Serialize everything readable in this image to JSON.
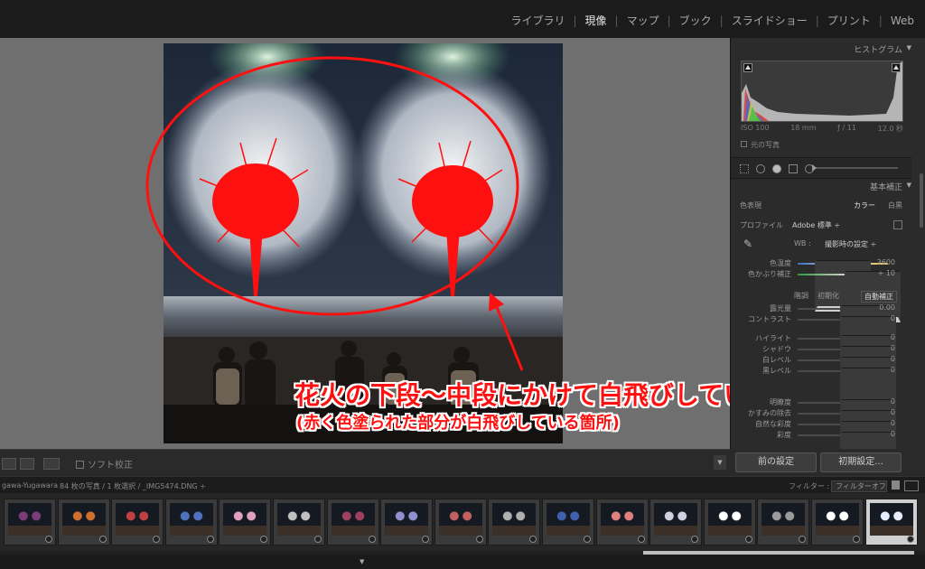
{
  "modules": {
    "items": [
      {
        "label": "ライブラリ",
        "active": false
      },
      {
        "label": "現像",
        "active": true
      },
      {
        "label": "マップ",
        "active": false
      },
      {
        "label": "ブック",
        "active": false
      },
      {
        "label": "スライドショー",
        "active": false
      },
      {
        "label": "プリント",
        "active": false
      },
      {
        "label": "Web",
        "active": false
      }
    ],
    "separator": "|"
  },
  "annotation": {
    "line1": "花火の下段〜中段にかけて白飛びしている",
    "line2": "(赤く色塗られた部分が白飛びしている箇所)",
    "color": "#ff0000"
  },
  "toolbar": {
    "soft_proof": "ソフト校正",
    "view_icons": [
      "loupe-view-icon",
      "before-after-icon",
      "yy-icon"
    ]
  },
  "histogram": {
    "title": "ヒストグラム",
    "iso": "ISO 100",
    "focal": "18 mm",
    "aperture": "ƒ / 11",
    "shutter": "12.0 秒",
    "original_photo": "元の写真"
  },
  "basic": {
    "title": "基本補正",
    "treatment_label": "色表現",
    "treatment_color": "カラー",
    "treatment_bw": "白黒",
    "profile_label": "プロファイル",
    "profile_value": "Adobe 標準 ÷",
    "wb_label": "WB :",
    "wb_value": "撮影時の設定 ÷",
    "tone_label": "階調",
    "reset_label": "初期化",
    "auto_label": "自動補正",
    "temp": {
      "label": "色温度",
      "value": "3600",
      "pos": 0.22
    },
    "tint": {
      "label": "色かぶり補正",
      "value": "+ 10",
      "pos": 0.55
    },
    "exposure": {
      "label": "露光量",
      "value": "0.00",
      "pos": 0.5
    },
    "contrast": {
      "label": "コントラスト",
      "value": "0",
      "pos": 0.5
    },
    "highlights": {
      "label": "ハイライト",
      "value": "0",
      "pos": 0.5
    },
    "shadows": {
      "label": "シャドウ",
      "value": "0",
      "pos": 0.5
    },
    "whites": {
      "label": "白レベル",
      "value": "0",
      "pos": 0.5
    },
    "blacks": {
      "label": "黒レベル",
      "value": "0",
      "pos": 0.5
    },
    "clarity": {
      "label": "明瞭度",
      "value": "0",
      "pos": 0.5
    },
    "dehaze": {
      "label": "かすみの除去",
      "value": "0",
      "pos": 0.5
    },
    "vibrance": {
      "label": "自然な彩度",
      "value": "0",
      "pos": 0.5
    },
    "saturation": {
      "label": "彩度",
      "value": "0",
      "pos": 0.5
    }
  },
  "buttons": {
    "previous": "前の設定",
    "reset": "初期設定..."
  },
  "filmstrip": {
    "source": "gawa-Yugawara",
    "info": "84 枚の写真 / 1 枚選択 / _IMG5474.DNG ÷",
    "filter_label": "フィルター :",
    "filter_value": "フィルターオフ ÷",
    "thumbnail_count": 17,
    "selected_index": 16
  }
}
